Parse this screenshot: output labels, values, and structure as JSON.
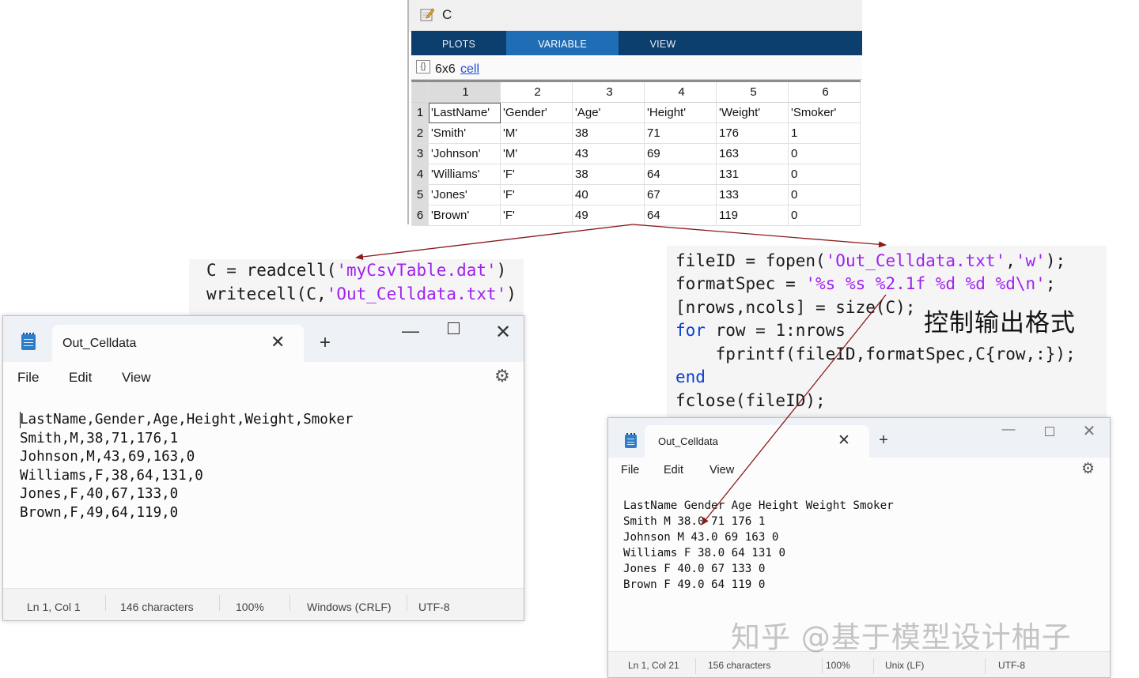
{
  "matlab": {
    "variable_name": "C",
    "tabs": [
      {
        "label": "PLOTS"
      },
      {
        "label": "VARIABLE"
      },
      {
        "label": "VIEW"
      }
    ],
    "size": "6x6",
    "type_link": "cell",
    "columns": [
      "1",
      "2",
      "3",
      "4",
      "5",
      "6"
    ],
    "rows": [
      {
        "n": "1",
        "cells": [
          "'LastName'",
          "'Gender'",
          "'Age'",
          "'Height'",
          "'Weight'",
          "'Smoker'"
        ]
      },
      {
        "n": "2",
        "cells": [
          "'Smith'",
          "'M'",
          "38",
          "71",
          "176",
          "1"
        ]
      },
      {
        "n": "3",
        "cells": [
          "'Johnson'",
          "'M'",
          "43",
          "69",
          "163",
          "0"
        ]
      },
      {
        "n": "4",
        "cells": [
          "'Williams'",
          "'F'",
          "38",
          "64",
          "131",
          "0"
        ]
      },
      {
        "n": "5",
        "cells": [
          "'Jones'",
          "'F'",
          "40",
          "67",
          "133",
          "0"
        ]
      },
      {
        "n": "6",
        "cells": [
          "'Brown'",
          "'F'",
          "49",
          "64",
          "119",
          "0"
        ]
      }
    ]
  },
  "code_left": {
    "line1_a": "C = readcell(",
    "line1_s": "'myCsvTable.dat'",
    "line1_b": ")",
    "line2_a": "writecell(C,",
    "line2_s": "'Out_Celldata.txt'",
    "line2_b": ")"
  },
  "code_right": {
    "l1_a": "fileID = fopen(",
    "l1_s1": "'Out_Celldata.txt'",
    "l1_m": ",",
    "l1_s2": "'w'",
    "l1_b": ");",
    "l2_a": "formatSpec = ",
    "l2_s": "'%s %s %2.1f %d %d %d\\n'",
    "l2_b": ";",
    "l3": "[nrows,ncols] = size(C);",
    "l4_kw": "for",
    "l4_b": " row = 1:nrows",
    "l5": "    fprintf(fileID,formatSpec,C{row,:});",
    "l6_kw": "end",
    "l7": "fclose(fileID);"
  },
  "annotation": "控制输出格式",
  "notepad_left": {
    "tab_title": "Out_Celldata",
    "menu": [
      "File",
      "Edit",
      "View"
    ],
    "content": "LastName,Gender,Age,Height,Weight,Smoker\nSmith,M,38,71,176,1\nJohnson,M,43,69,163,0\nWilliams,F,38,64,131,0\nJones,F,40,67,133,0\nBrown,F,49,64,119,0",
    "status": {
      "position": "Ln 1, Col 1",
      "chars": "146 characters",
      "zoom": "100%",
      "eol": "Windows (CRLF)",
      "encoding": "UTF-8"
    }
  },
  "notepad_right": {
    "tab_title": "Out_Celldata",
    "menu": [
      "File",
      "Edit",
      "View"
    ],
    "content": "LastName Gender Age Height Weight Smoker\nSmith M 38.0 71 176 1\nJohnson M 43.0 69 163 0\nWilliams F 38.0 64 131 0\nJones F 40.0 67 133 0\nBrown F 49.0 64 119 0",
    "status": {
      "position": "Ln 1, Col 21",
      "chars": "156 characters",
      "zoom": "100%",
      "eol": "Unix (LF)",
      "encoding": "UTF-8"
    }
  },
  "watermark": "知乎 @基于模型设计柚子",
  "colors": {
    "matlab_tabbar": "#0c3e6e",
    "matlab_tab_active": "#1f6eb5",
    "string": "#a020f0",
    "keyword": "#0b3fd1",
    "arrow": "#8b1a1a"
  }
}
